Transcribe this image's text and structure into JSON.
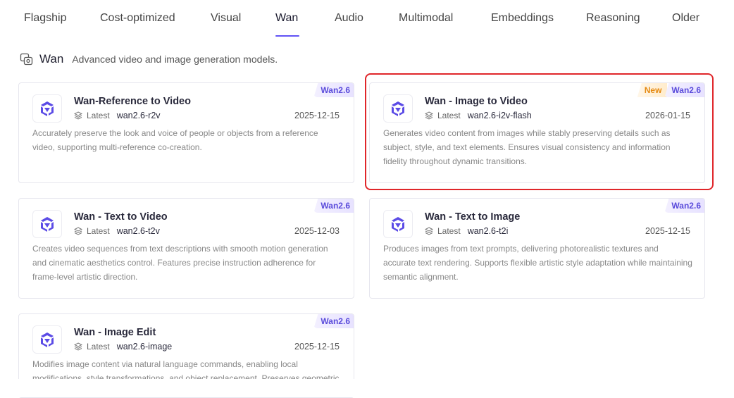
{
  "tabs": [
    {
      "label": "Flagship",
      "active": false
    },
    {
      "label": "Cost-optimized",
      "active": false
    },
    {
      "label": "Visual",
      "active": false
    },
    {
      "label": "Wan",
      "active": true
    },
    {
      "label": "Audio",
      "active": false
    },
    {
      "label": "Multimodal",
      "active": false
    },
    {
      "label": "Embeddings",
      "active": false
    },
    {
      "label": "Reasoning",
      "active": false
    },
    {
      "label": "Older",
      "active": false
    }
  ],
  "section": {
    "title": "Wan",
    "description": "Advanced video and image generation models.",
    "icon": "image-video-icon"
  },
  "cards": [
    {
      "name": "Wan-Reference to Video",
      "latest_label": "Latest",
      "model": "wan2.6-r2v",
      "date": "2025-12-15",
      "version": "Wan2.6",
      "new_badge": "",
      "description": "Accurately preserve the look and voice of people or objects from a reference video, supporting multi-reference co-creation."
    },
    {
      "name": "Wan - Image to Video",
      "latest_label": "Latest",
      "model": "wan2.6-i2v-flash",
      "date": "2026-01-15",
      "version": "Wan2.6",
      "new_badge": "New",
      "description": "Generates video content from images while stably preserving details such as subject, style, and text elements. Ensures visual consistency and information fidelity throughout dynamic transitions."
    },
    {
      "name": "Wan - Text to Video",
      "latest_label": "Latest",
      "model": "wan2.6-t2v",
      "date": "2025-12-03",
      "version": "Wan2.6",
      "new_badge": "",
      "description": "Creates video sequences from text descriptions with smooth motion generation and cinematic aesthetics control. Features precise instruction adherence for frame-level artistic direction."
    },
    {
      "name": "Wan - Text to Image",
      "latest_label": "Latest",
      "model": "wan2.6-t2i",
      "date": "2025-12-15",
      "version": "Wan2.6",
      "new_badge": "",
      "description": "Produces images from text prompts, delivering photorealistic textures and accurate text rendering. Supports flexible artistic style adaptation while maintaining semantic alignment."
    },
    {
      "name": "Wan - Image Edit",
      "latest_label": "Latest",
      "model": "wan2.6-image",
      "date": "2025-12-15",
      "version": "Wan2.6",
      "new_badge": "",
      "description": "Modifies image content via natural language commands, enabling local modifications, style transformations, and object replacement. Preserves geometric"
    }
  ],
  "colors": {
    "accent": "#6152f5",
    "highlight_border": "#e0262a",
    "badge_new": "#e58a12"
  }
}
